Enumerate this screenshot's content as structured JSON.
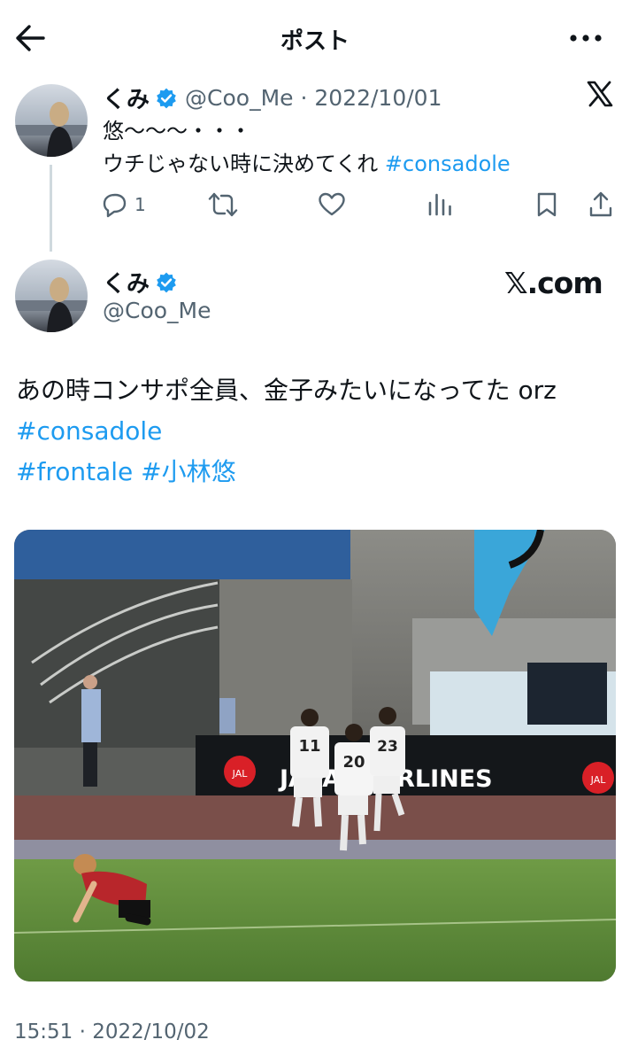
{
  "header": {
    "title": "ポスト",
    "back_icon": "arrow-left-icon",
    "more_icon": "more-horizontal-icon"
  },
  "reply_tweet": {
    "display_name": "くみ",
    "verified": true,
    "handle_date": "@Coo_Me · 2022/10/01",
    "text_line1": "悠〜〜〜・・・",
    "text_line2": "ウチじゃない時に決めてくれ",
    "hashtag": "#consadole",
    "actions": {
      "reply_count": "1",
      "reply_icon": "reply-icon",
      "retweet_icon": "retweet-icon",
      "like_icon": "heart-icon",
      "views_icon": "views-icon",
      "bookmark_icon": "bookmark-icon",
      "share_icon": "share-icon"
    },
    "platform_icon": "x-logo-icon"
  },
  "main_tweet": {
    "display_name": "くみ",
    "verified": true,
    "handle": "@Coo_Me",
    "source_logo": "𝕏.com",
    "text_line1": "あの時コンサポ全員、金子みたいになってた orz",
    "hashtag1": "#consadole",
    "hashtag2": "#frontale",
    "hashtag3": "#小林悠",
    "media": {
      "banner_text": "JAPAN AIRLINES",
      "jal_badge": "JAL",
      "player_numbers": [
        "11",
        "20",
        "23"
      ]
    },
    "timestamp": "15:51 · 2022/10/02"
  },
  "colors": {
    "accent": "#1d9bf0",
    "secondary_text": "#536471",
    "text": "#0f1419"
  }
}
